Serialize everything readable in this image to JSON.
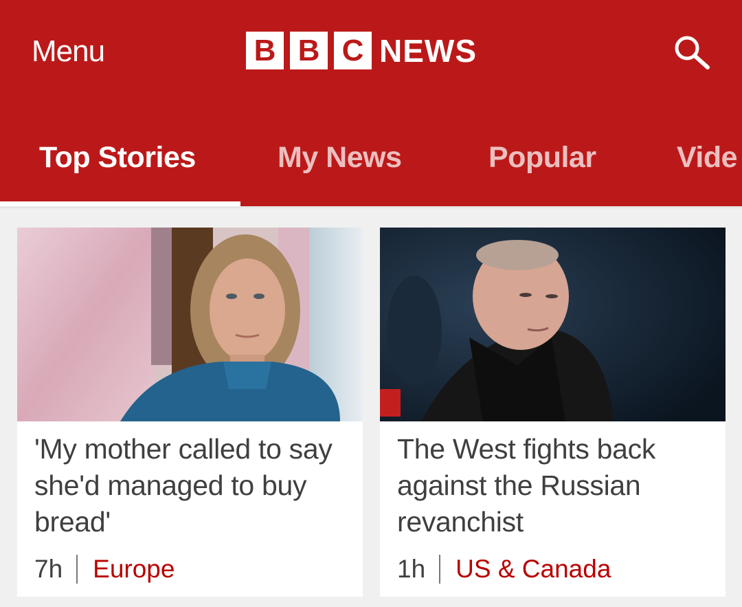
{
  "header": {
    "menu_label": "Menu",
    "logo_letters": [
      "B",
      "B",
      "C"
    ],
    "logo_word": "NEWS",
    "search_icon": "search-icon",
    "brand_color": "#bb1919"
  },
  "tabs": [
    {
      "label": "Top Stories",
      "active": true
    },
    {
      "label": "My News",
      "active": false
    },
    {
      "label": "Popular",
      "active": false
    },
    {
      "label": "Vide",
      "active": false
    }
  ],
  "stories": [
    {
      "headline": "'My mother called to say she'd managed to buy bread'",
      "age": "7h",
      "section": "Europe"
    },
    {
      "headline": "The West fights back against the Russian revanchist",
      "age": "1h",
      "section": "US & Canada"
    }
  ]
}
